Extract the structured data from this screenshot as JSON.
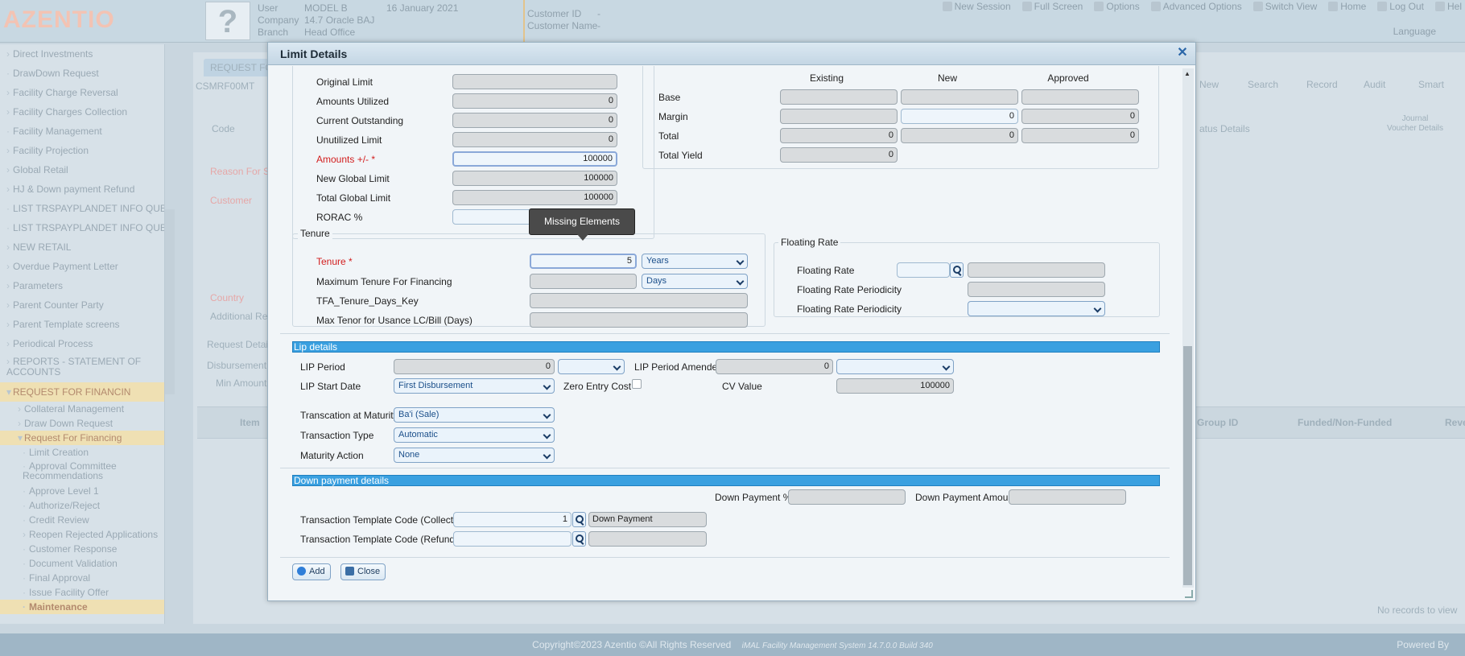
{
  "header": {
    "logo": "AZENTIO",
    "user_label": "User",
    "user_value": "MODEL B",
    "company_label": "Company",
    "company_value": "14.7 Oracle BAJ",
    "branch_label": "Branch",
    "branch_value": "Head Office",
    "date": "16 January 2021",
    "customer_id_label": "Customer ID",
    "customer_id_value": "-",
    "customer_name_label": "Customer Name",
    "customer_name_value": "-",
    "links": [
      "New Session",
      "Full Screen",
      "Options",
      "Advanced Options",
      "Switch View",
      "Home",
      "Log Out",
      "Hel"
    ],
    "language_label": "Language"
  },
  "sidebar": {
    "items": [
      "Direct Investments",
      "DrawDown Request",
      "Facility Charge Reversal",
      "Facility Charges Collection",
      "Facility Management",
      "Facility Projection",
      "Global Retail",
      "HJ & Down payment Refund",
      "LIST TRSPAYPLANDET INFO QUERY",
      "LIST TRSPAYPLANDET INFO QUERY",
      "NEW RETAIL",
      "Overdue Payment Letter",
      "Parameters",
      "Parent Counter Party",
      "Parent Template screens",
      "Periodical Process",
      "REPORTS - STATEMENT OF ACCOUNTS",
      "REQUEST FOR FINANCIN"
    ],
    "sub_items": [
      "Collateral Management",
      "Draw Down Request",
      "Request For Financing"
    ],
    "sub2_items": [
      "Limit Creation",
      "Approval Committee Recommendations",
      "Approve Level 1",
      "Authorize/Reject",
      "Credit Review",
      "Reopen Rejected Applications",
      "Customer Response",
      "Document Validation",
      "Final Approval",
      "Issue Facility Offer",
      "Maintenance"
    ]
  },
  "background": {
    "tab": "REQUEST FOR",
    "screen_id": "CSMRF00MT",
    "code_label": "Code",
    "reason_label": "Reason For Su",
    "customer_label": "Customer",
    "country_label": "Country",
    "additional_ref_label": "Additional Refe",
    "request_details_label": "Request Details",
    "disbursement_label": "Disbursement",
    "min_amount_label": "Min Amount",
    "toolbar": [
      "New",
      "Search",
      "Record",
      "Audit",
      "Smart"
    ],
    "status_details": "atus Details",
    "journal_voucher": "Journal Voucher Details",
    "table_headers": [
      "Item",
      "Group ID",
      "Funded/Non-Funded",
      "Reve"
    ],
    "no_records": "No records to view"
  },
  "modal": {
    "title": "Limit Details",
    "limits": {
      "original_limit_label": "Original Limit",
      "original_limit_value": "",
      "amounts_utilized_label": "Amounts Utilized",
      "amounts_utilized_value": "0",
      "current_outstanding_label": "Current Outstanding",
      "current_outstanding_value": "0",
      "unutilized_limit_label": "Unutilized Limit",
      "unutilized_limit_value": "0",
      "amounts_pm_label": "Amounts +/- *",
      "amounts_pm_value": "100000",
      "new_global_limit_label": "New Global Limit",
      "new_global_limit_value": "100000",
      "total_global_limit_label": "Total Global Limit",
      "total_global_limit_value": "100000",
      "rorac_label": "RORAC %"
    },
    "yield": {
      "col_existing": "Existing",
      "col_new": "New",
      "col_approved": "Approved",
      "base_label": "Base",
      "margin_label": "Margin",
      "margin_new": "0",
      "margin_approved": "0",
      "total_label": "Total",
      "total_existing": "0",
      "total_new": "0",
      "total_approved": "0",
      "total_yield_label": "Total Yield",
      "total_yield_existing": "0"
    },
    "tooltip": "Missing Elements",
    "tenure": {
      "legend": "Tenure",
      "tenure_label": "Tenure *",
      "tenure_value": "5",
      "tenure_unit": "Years",
      "max_tenure_label": "Maximum Tenure For Financing",
      "max_tenure_unit": "Days",
      "tfa_label": "TFA_Tenure_Days_Key",
      "max_tenor_label": "Max Tenor for Usance LC/Bill (Days)"
    },
    "floating": {
      "legend": "Floating Rate",
      "rate_label": "Floating Rate",
      "periodicity_label": "Floating Rate Periodicity",
      "periodicity2_label": "Floating Rate Periodicity"
    },
    "lip": {
      "section": "Lip details",
      "period_label": "LIP Period",
      "period_value": "0",
      "period_amended_label": "LIP Period Amended",
      "period_amended_value": "0",
      "start_date_label": "LIP Start Date",
      "start_date_value": "First Disbursement",
      "zero_entry_label": "Zero Entry Cost",
      "cv_value_label": "CV Value",
      "cv_value": "100000",
      "txn_maturity_label": "Transcation at Maturity",
      "txn_maturity_value": "Ba'i (Sale)",
      "txn_type_label": "Transaction Type",
      "txn_type_value": "Automatic",
      "maturity_action_label": "Maturity Action",
      "maturity_action_value": "None"
    },
    "down_payment": {
      "section": "Down payment details",
      "pct_label": "Down Payment %",
      "amount_label": "Down Payment Amount",
      "collection_label": "Transaction Template Code (Collection)",
      "collection_value": "1",
      "collection_desc": "Down Payment",
      "refund_label": "Transaction Template Code (Refund)"
    },
    "buttons": {
      "add": "Add",
      "close": "Close"
    }
  },
  "footer": {
    "copyright": "Copyright©2023 Azentio ©All Rights Reserved",
    "system": "iMAL Facility Management System 14.7.0.0 Build 340",
    "powered": "Powered By"
  }
}
